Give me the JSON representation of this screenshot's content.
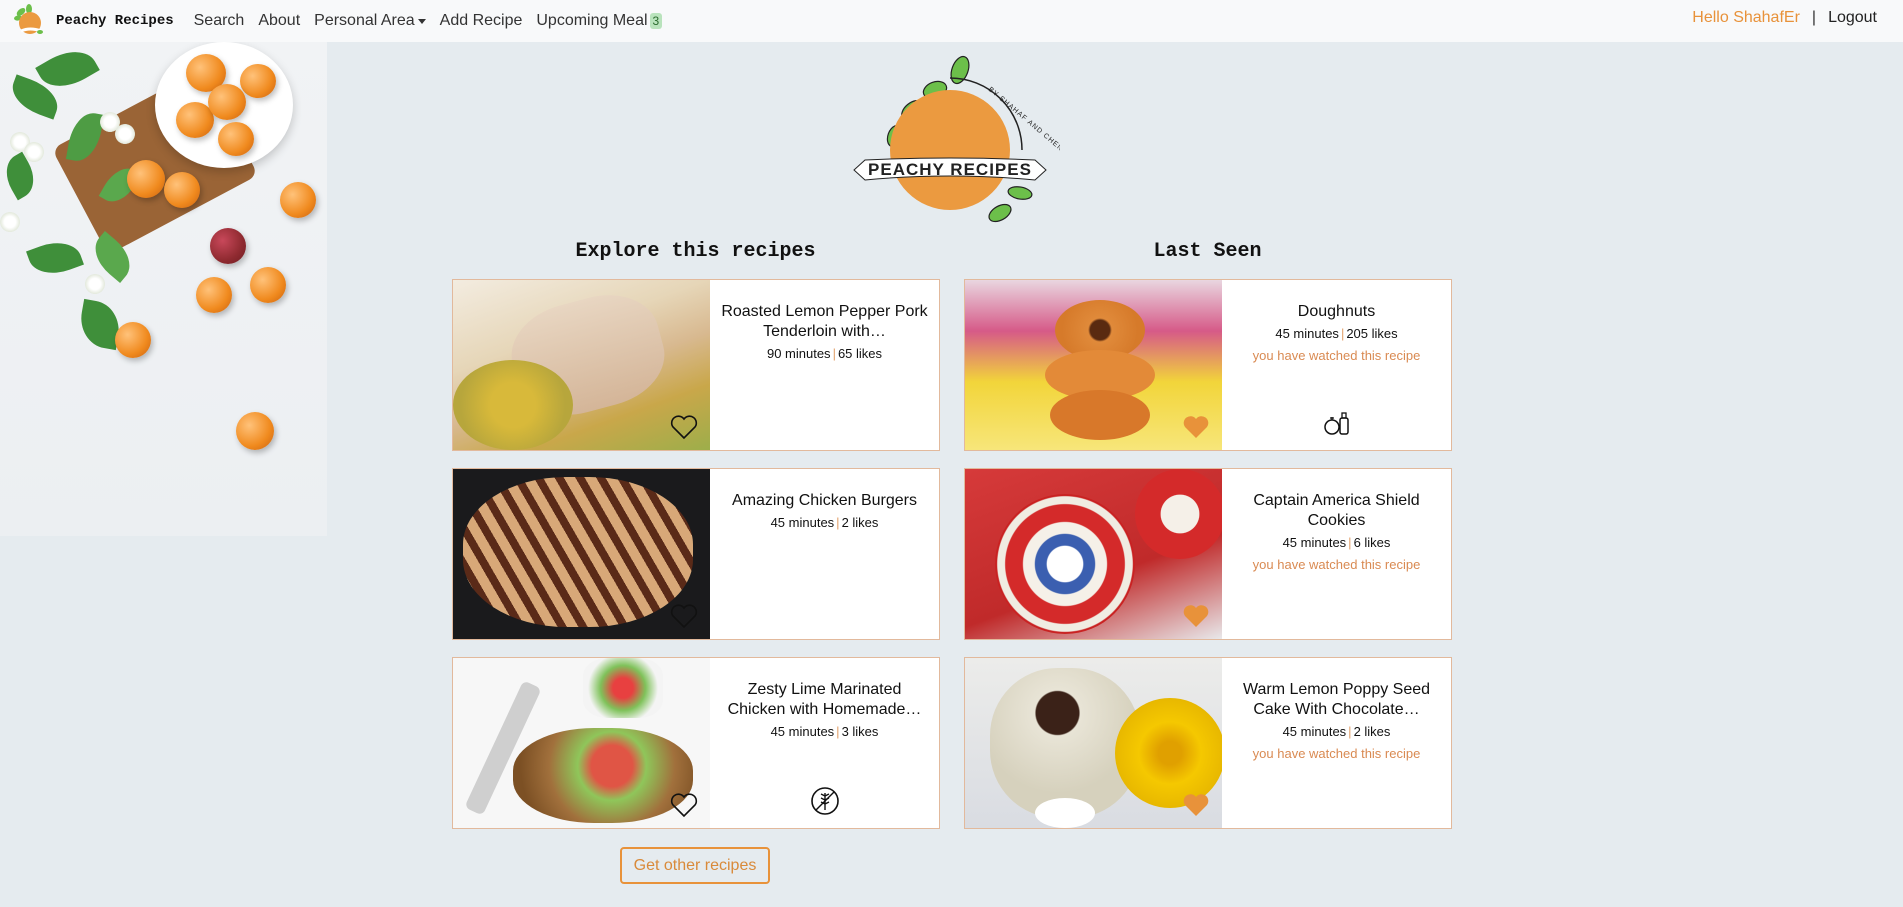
{
  "navbar": {
    "brand": "Peachy Recipes",
    "items": [
      {
        "label": "Search"
      },
      {
        "label": "About"
      },
      {
        "label": "Personal Area"
      },
      {
        "label": "Add Recipe"
      },
      {
        "label": "Upcoming Meal"
      }
    ],
    "upcoming_count": "3",
    "greeting": "Hello ShahafEr",
    "separator": "|",
    "logout": "Logout"
  },
  "logo": {
    "text": "PEACHY RECIPES",
    "byline": "BY SHAHAF AND CHEN"
  },
  "explore": {
    "title": "Explore this recipes",
    "cards": [
      {
        "title": "Roasted Lemon Pepper Pork Tenderloin with…",
        "minutes": "90 minutes",
        "likes": "65 likes",
        "favorite": false,
        "icon": "",
        "watched": ""
      },
      {
        "title": "Amazing Chicken Burgers",
        "minutes": "45 minutes",
        "likes": "2 likes",
        "favorite": false,
        "icon": "",
        "watched": ""
      },
      {
        "title": "Zesty Lime Marinated Chicken with Homemade…",
        "minutes": "45 minutes",
        "likes": "3 likes",
        "favorite": false,
        "icon": "gluten-free-icon",
        "watched": ""
      }
    ],
    "more_button": "Get other recipes"
  },
  "last_seen": {
    "title": "Last Seen",
    "cards": [
      {
        "title": "Doughnuts",
        "minutes": "45 minutes",
        "likes": "205 likes",
        "favorite": true,
        "icon": "vegetarian-icon",
        "watched": "you have watched this recipe"
      },
      {
        "title": "Captain America Shield Cookies",
        "minutes": "45 minutes",
        "likes": "6 likes",
        "favorite": true,
        "icon": "",
        "watched": "you have watched this recipe"
      },
      {
        "title": "Warm Lemon Poppy Seed Cake With Chocolate…",
        "minutes": "45 minutes",
        "likes": "2 likes",
        "favorite": true,
        "icon": "",
        "watched": "you have watched this recipe"
      }
    ]
  },
  "colors": {
    "accent": "#e8923a",
    "background": "#e5ebef",
    "card_border": "#e2b99c"
  }
}
